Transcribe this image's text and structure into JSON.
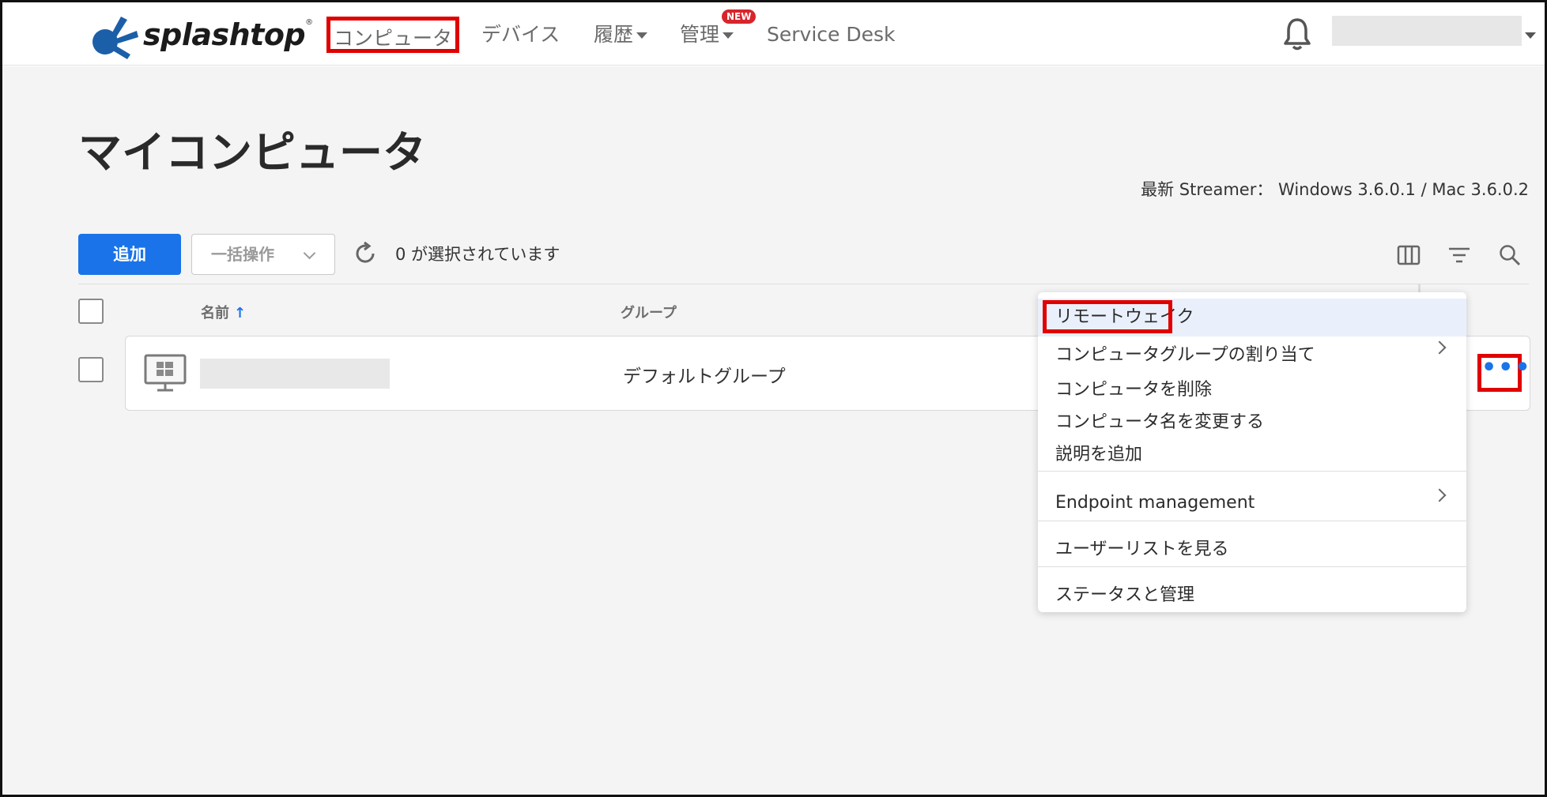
{
  "header": {
    "logo_text": "splashtop",
    "logo_reg": "®",
    "nav": {
      "computers": "コンピュータ",
      "devices": "デバイス",
      "history": "履歴",
      "admin": "管理",
      "new_badge": "NEW",
      "service_desk": "Service Desk"
    }
  },
  "page": {
    "title": "マイコンピュータ",
    "streamer_info": "最新 Streamer： Windows 3.6.0.1 / Mac 3.6.0.2"
  },
  "toolbar": {
    "add_label": "追加",
    "bulk_label": "一括操作",
    "selected_text": "0 が選択されています"
  },
  "table": {
    "headers": {
      "name": "名前",
      "sort_arrow": "↑",
      "group": "グループ"
    },
    "rows": [
      {
        "group": "デフォルトグループ"
      }
    ],
    "more_label": "•••"
  },
  "context_menu": {
    "items": [
      "リモートウェイク",
      "コンピュータグループの割り当て",
      "コンピュータを削除",
      "コンピュータ名を変更する",
      "説明を追加",
      "Endpoint management",
      "ユーザーリストを見る",
      "ステータスと管理"
    ]
  },
  "colors": {
    "accent": "#1a73e8",
    "highlight": "#e00000",
    "badge": "#d8252b",
    "logo_blue": "#1b5fa8"
  },
  "icons": [
    "splashtop-logo-icon",
    "bell-icon",
    "refresh-icon",
    "columns-icon",
    "filter-icon",
    "search-icon",
    "monitor-windows-icon",
    "more-icon",
    "chevron-right-icon",
    "chevron-down-icon"
  ]
}
